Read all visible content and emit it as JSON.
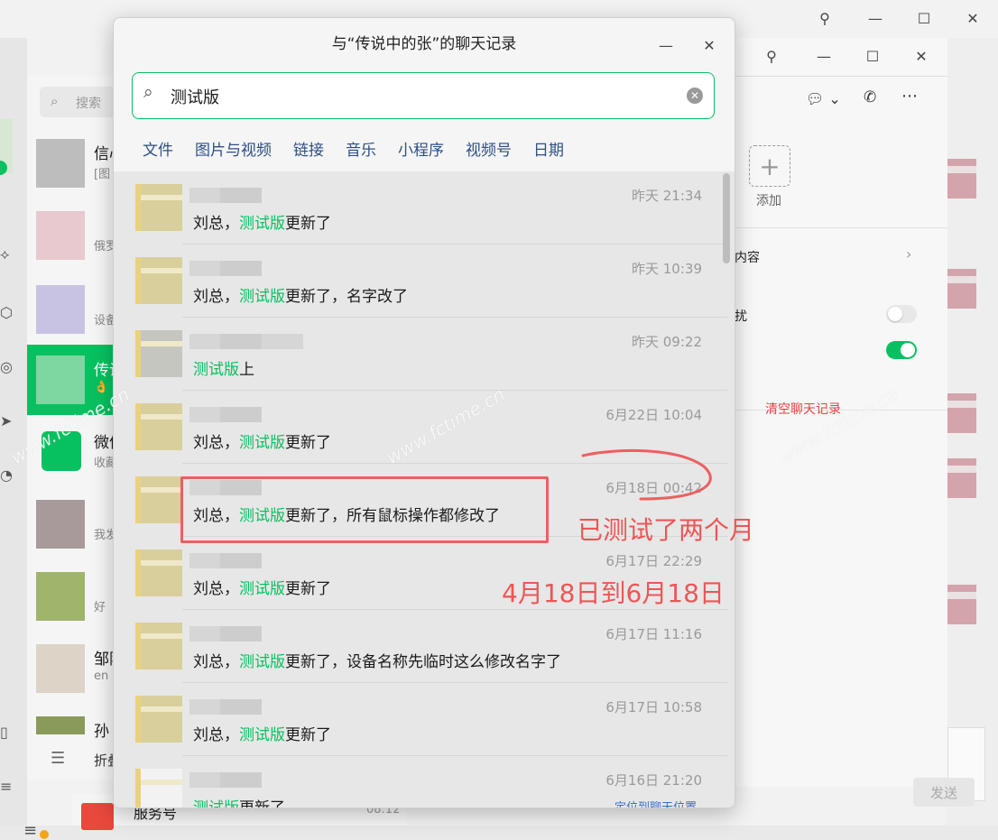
{
  "background": {
    "sidebar_search_placeholder": "搜索",
    "chats": [
      {
        "name": "信心",
        "preview": "[图"
      },
      {
        "name": "",
        "preview": "俄罗"
      },
      {
        "name": "",
        "preview": "设备"
      },
      {
        "name": "传说",
        "preview": "👌"
      },
      {
        "name": "微信",
        "preview": "收藏"
      },
      {
        "name": "",
        "preview": "我发"
      },
      {
        "name": "",
        "preview": "好"
      },
      {
        "name": "邹阳",
        "preview": "en"
      },
      {
        "name": "孙",
        "preview": ""
      }
    ],
    "fold_label": "折叠",
    "service_name": "服务号",
    "service_time": "08:12",
    "add_label": "添加",
    "content_label": "内容",
    "dnd_label": "扰",
    "clear_history": "清空聊天记录",
    "send_button": "发送",
    "locate_link": "定位到聊天位置"
  },
  "dialog": {
    "title": "与“传说中的张”的聊天记录",
    "search": {
      "value": "测试版"
    },
    "filters": [
      "文件",
      "图片与视频",
      "链接",
      "音乐",
      "小程序",
      "视频号",
      "日期"
    ],
    "keyword": "测试版",
    "results": [
      {
        "time": "昨天 21:34",
        "pre": "刘总，",
        "post": "更新了"
      },
      {
        "time": "昨天 10:39",
        "pre": "刘总，",
        "post": "更新了，名字改了"
      },
      {
        "time": "昨天 09:22",
        "pre": "",
        "post": "上"
      },
      {
        "time": "6月22日 10:04",
        "pre": "刘总，",
        "post": "更新了"
      },
      {
        "time": "6月18日 00:42",
        "pre": "刘总，",
        "post": "更新了，所有鼠标操作都修改了"
      },
      {
        "time": "6月17日 22:29",
        "pre": "刘总，",
        "post": "更新了"
      },
      {
        "time": "6月17日 11:16",
        "pre": "刘总，",
        "post": "更新了，设备名称先临时这么修改名字了"
      },
      {
        "time": "6月17日 10:58",
        "pre": "刘总，",
        "post": "更新了"
      },
      {
        "time": "6月16日 21:20",
        "pre": "",
        "post": "更新了"
      }
    ]
  },
  "annotations": {
    "text1": "已测试了两个月",
    "text2": "4月18日到6月18日",
    "color": "#ee5555"
  },
  "watermark": "www.fctime.cn",
  "colors": {
    "accent": "#07c160",
    "annotation": "#ee5f5f"
  }
}
